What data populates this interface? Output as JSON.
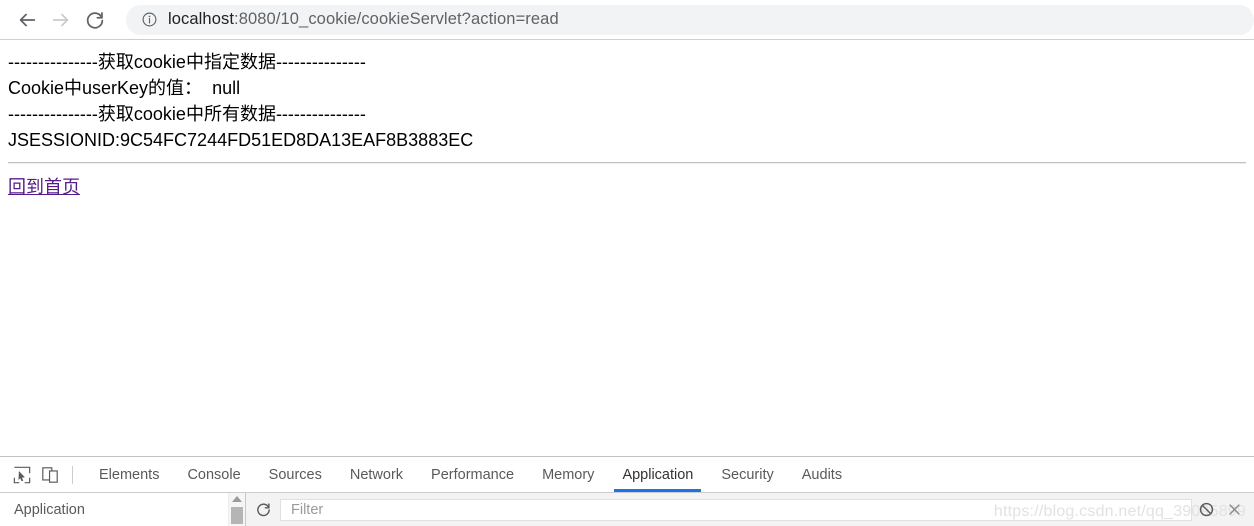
{
  "browser": {
    "back_label": "Back",
    "forward_label": "Forward",
    "reload_label": "Reload",
    "url_host": "localhost",
    "url_rest": ":8080/10_cookie/cookieServlet?action=read",
    "url_full": "localhost:8080/10_cookie/cookieServlet?action=read"
  },
  "page": {
    "line1": "---------------获取cookie中指定数据---------------",
    "line2": "Cookie中userKey的值：  null",
    "line3": "---------------获取cookie中所有数据---------------",
    "line4": "JSESSIONID:9C54FC7244FD51ED8DA13EAF8B3883EC",
    "home_link": "回到首页"
  },
  "devtools": {
    "inspect_title": "Inspect element",
    "device_title": "Toggle device toolbar",
    "tabs": [
      {
        "label": "Elements",
        "active": false
      },
      {
        "label": "Console",
        "active": false
      },
      {
        "label": "Sources",
        "active": false
      },
      {
        "label": "Network",
        "active": false
      },
      {
        "label": "Performance",
        "active": false
      },
      {
        "label": "Memory",
        "active": false
      },
      {
        "label": "Application",
        "active": true
      },
      {
        "label": "Security",
        "active": false
      },
      {
        "label": "Audits",
        "active": false
      }
    ],
    "active_tab": "Application",
    "sidebar_title": "Application",
    "refresh_label": "Refresh",
    "filter_placeholder": "Filter",
    "filter_value": "",
    "clear_label": "Clear",
    "close_label": "Delete selected",
    "accent_color": "#1a73e8"
  },
  "watermark": {
    "text": "https://blog.csdn.net/qq_39095899"
  }
}
